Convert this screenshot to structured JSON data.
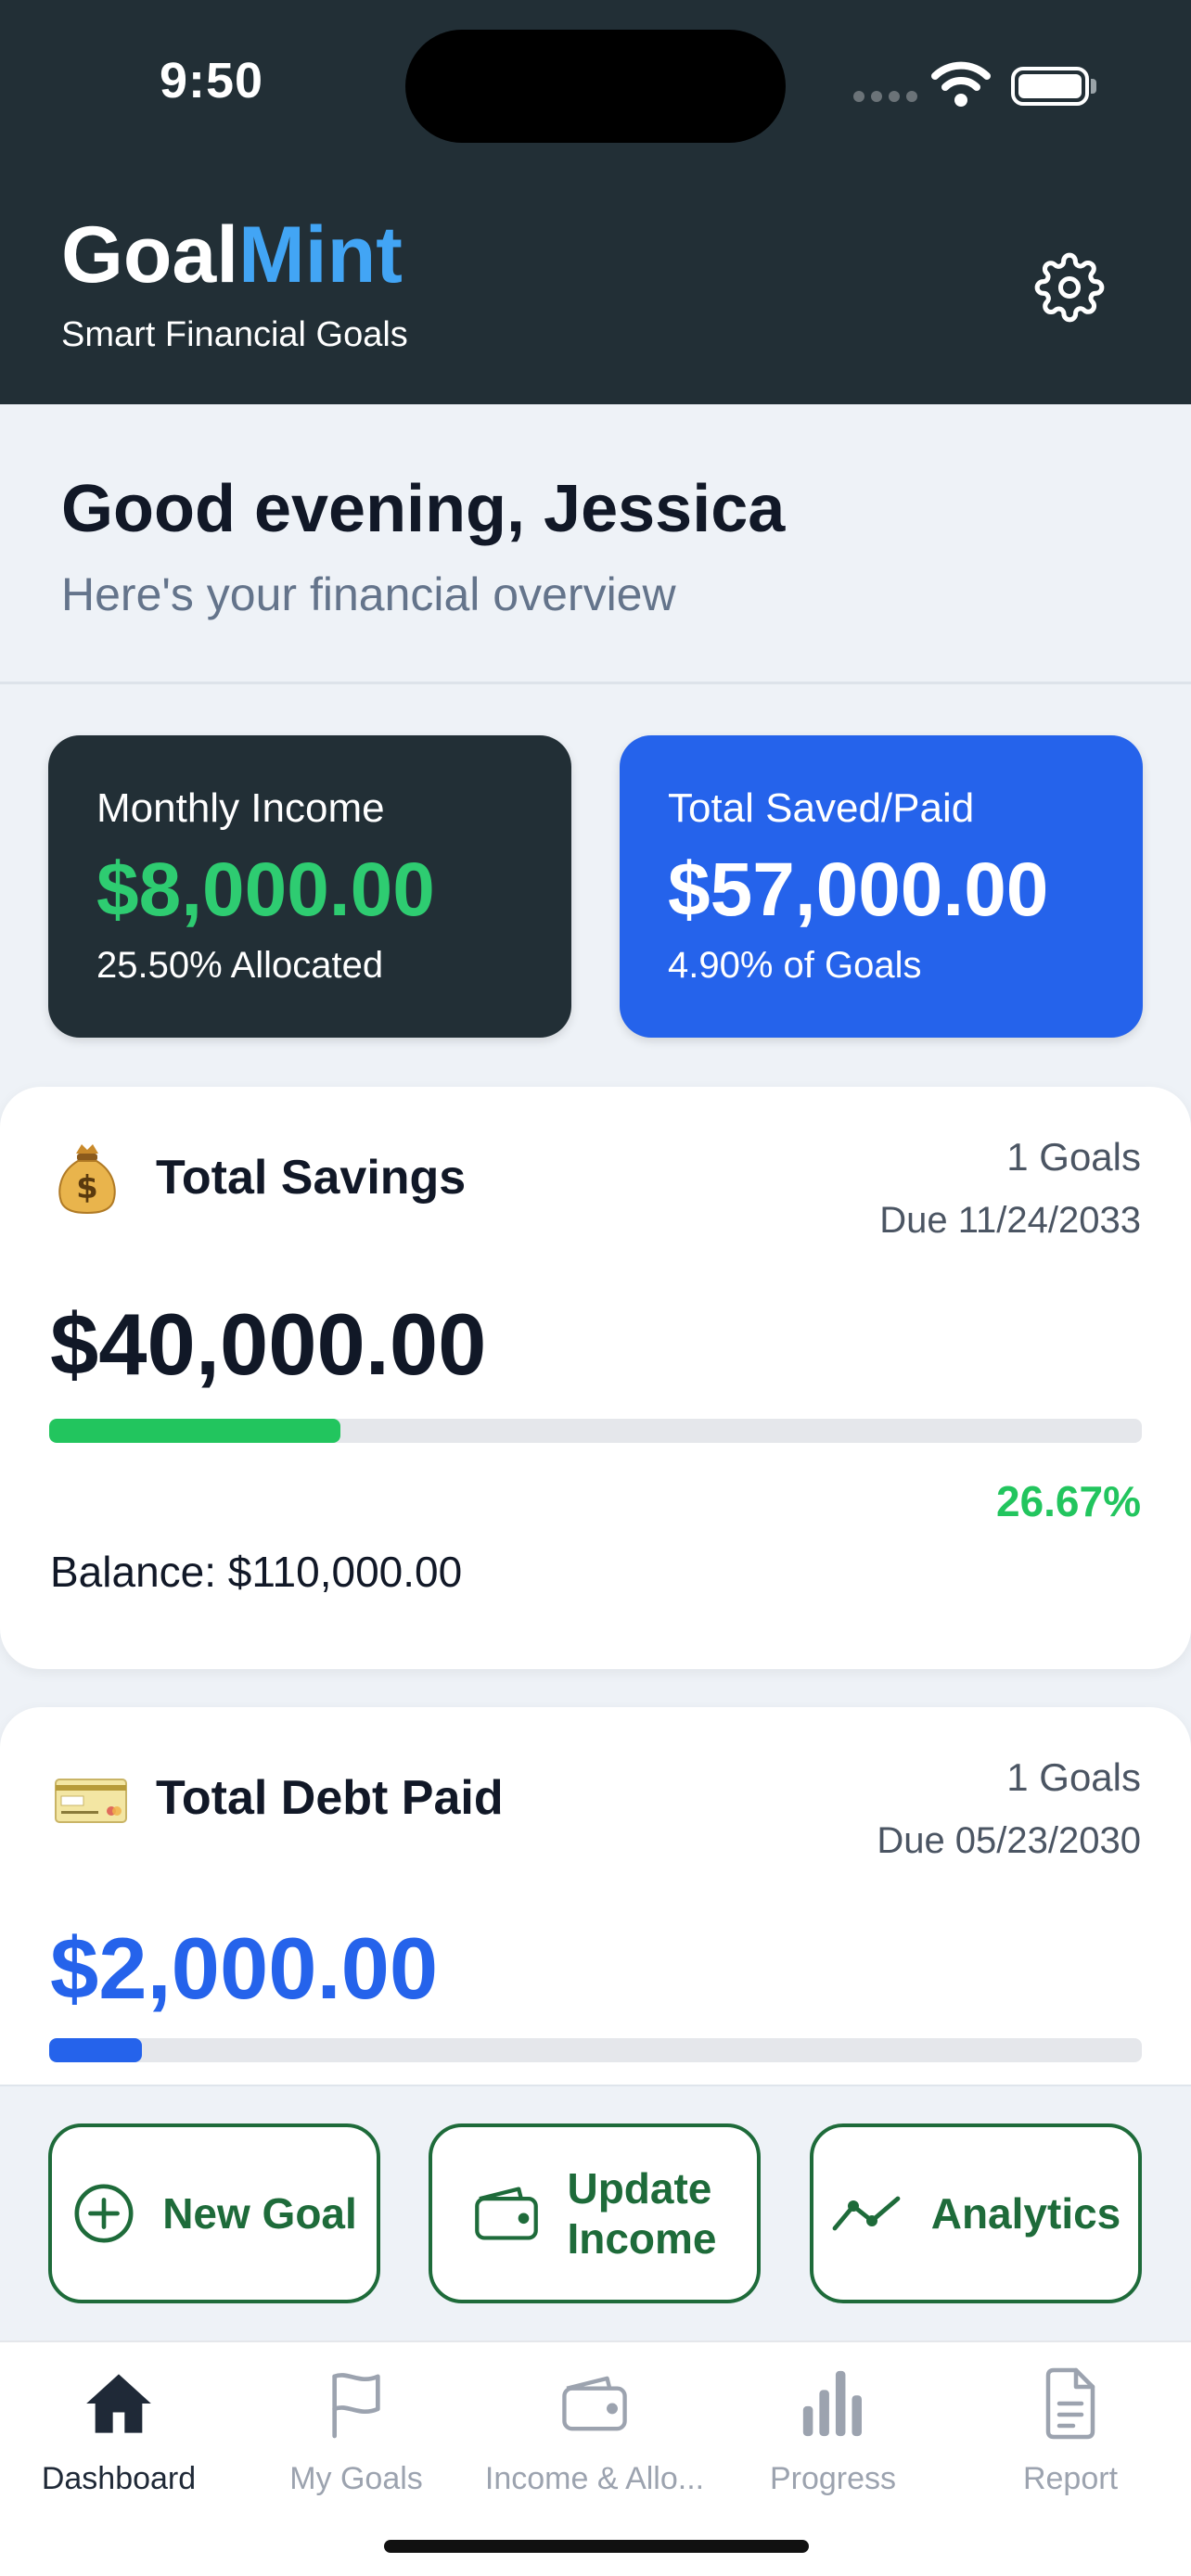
{
  "status_bar": {
    "time": "9:50"
  },
  "header": {
    "brand_main": "Goal",
    "brand_accent": "Mint",
    "tagline": "Smart Financial Goals",
    "settings_icon": "gear-icon"
  },
  "greeting": {
    "title": "Good evening, Jessica",
    "subtitle": "Here's your financial overview"
  },
  "stats": {
    "income": {
      "label": "Monthly Income",
      "value": "$8,000.00",
      "note": "25.50% Allocated"
    },
    "saved": {
      "label": "Total Saved/Paid",
      "value": "$57,000.00",
      "note": "4.90% of Goals"
    }
  },
  "savings_card": {
    "icon": "money-bag-icon",
    "title": "Total Savings",
    "count": "1 Goals",
    "due": "Due 11/24/2033",
    "amount": "$40,000.00",
    "progress_percent": 26.67,
    "percent_label": "26.67%",
    "balance": "Balance: $110,000.00"
  },
  "debt_card": {
    "icon": "credit-card-icon",
    "title": "Total Debt Paid",
    "count": "1 Goals",
    "due": "Due 05/23/2030",
    "amount": "$2,000.00",
    "progress_percent": 8.5
  },
  "actions": {
    "new_goal": "New Goal",
    "update_income_line1": "Update",
    "update_income_line2": "Income",
    "analytics": "Analytics"
  },
  "tabs": [
    {
      "label": "Dashboard",
      "icon": "home-icon",
      "active": true
    },
    {
      "label": "My Goals",
      "icon": "flag-icon",
      "active": false
    },
    {
      "label": "Income & Allo...",
      "icon": "wallet-icon",
      "active": false
    },
    {
      "label": "Progress",
      "icon": "bar-chart-icon",
      "active": false
    },
    {
      "label": "Report",
      "icon": "document-icon",
      "active": false
    }
  ],
  "colors": {
    "header_bg": "#222f36",
    "brand_accent": "#42a5f5",
    "income_green": "#2ecc71",
    "primary_blue": "#2563eb",
    "action_green": "#1e6b3a"
  }
}
